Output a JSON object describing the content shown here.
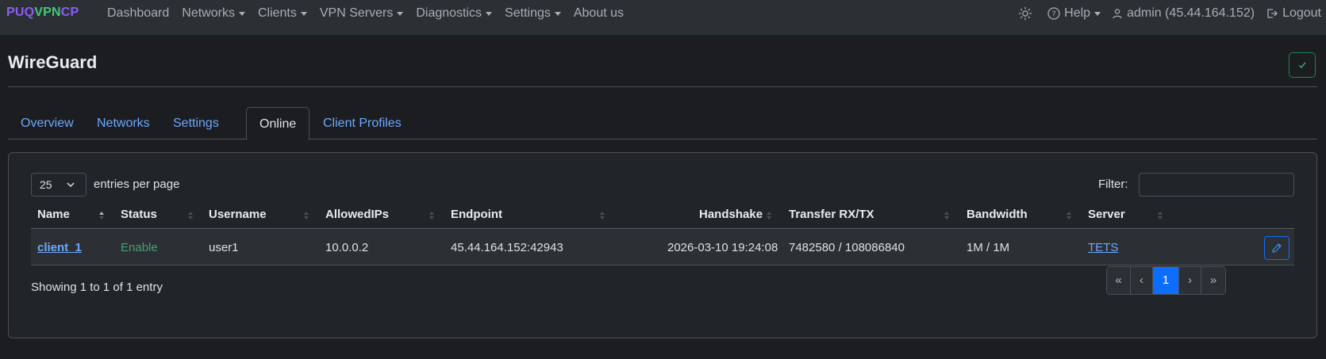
{
  "brand": {
    "part1": "PUQ",
    "part2": "VPN",
    "part3": "CP"
  },
  "nav": {
    "items": [
      {
        "label": "Dashboard",
        "dropdown": false
      },
      {
        "label": "Networks",
        "dropdown": true
      },
      {
        "label": "Clients",
        "dropdown": true
      },
      {
        "label": "VPN Servers",
        "dropdown": true
      },
      {
        "label": "Diagnostics",
        "dropdown": true
      },
      {
        "label": "Settings",
        "dropdown": true
      },
      {
        "label": "About us",
        "dropdown": false
      }
    ],
    "help": "Help",
    "user": "admin (45.44.164.152)",
    "logout": "Logout"
  },
  "page": {
    "title": "WireGuard"
  },
  "tabs": [
    {
      "label": "Overview",
      "active": false
    },
    {
      "label": "Networks",
      "active": false
    },
    {
      "label": "Settings",
      "active": false
    },
    {
      "label": "Online",
      "active": true
    },
    {
      "label": "Client Profiles",
      "active": false
    }
  ],
  "table": {
    "length_value": "25",
    "length_label": "entries per page",
    "filter_label": "Filter:",
    "filter_value": "",
    "columns": [
      "Name",
      "Status",
      "Username",
      "AllowedIPs",
      "Endpoint",
      "Handshake",
      "Transfer RX/TX",
      "Bandwidth",
      "Server"
    ],
    "rows": [
      {
        "name": "client_1",
        "status": "Enable",
        "username": "user1",
        "allowed_ips": "10.0.0.2",
        "endpoint": "45.44.164.152:42943",
        "handshake": "2026-03-10 19:24:08",
        "transfer": "7482580 / 108086840",
        "bandwidth": "1M / 1M",
        "server": "TETS"
      }
    ],
    "info": "Showing 1 to 1 of 1 entry",
    "pagination": {
      "first": "«",
      "prev": "‹",
      "current": "1",
      "next": "›",
      "last": "»"
    }
  },
  "colors": {
    "accent": "#0d6efd",
    "link": "#6ea8fe",
    "success": "#198754",
    "brand_purple": "#8f5cf6",
    "brand_green": "#42c978"
  }
}
